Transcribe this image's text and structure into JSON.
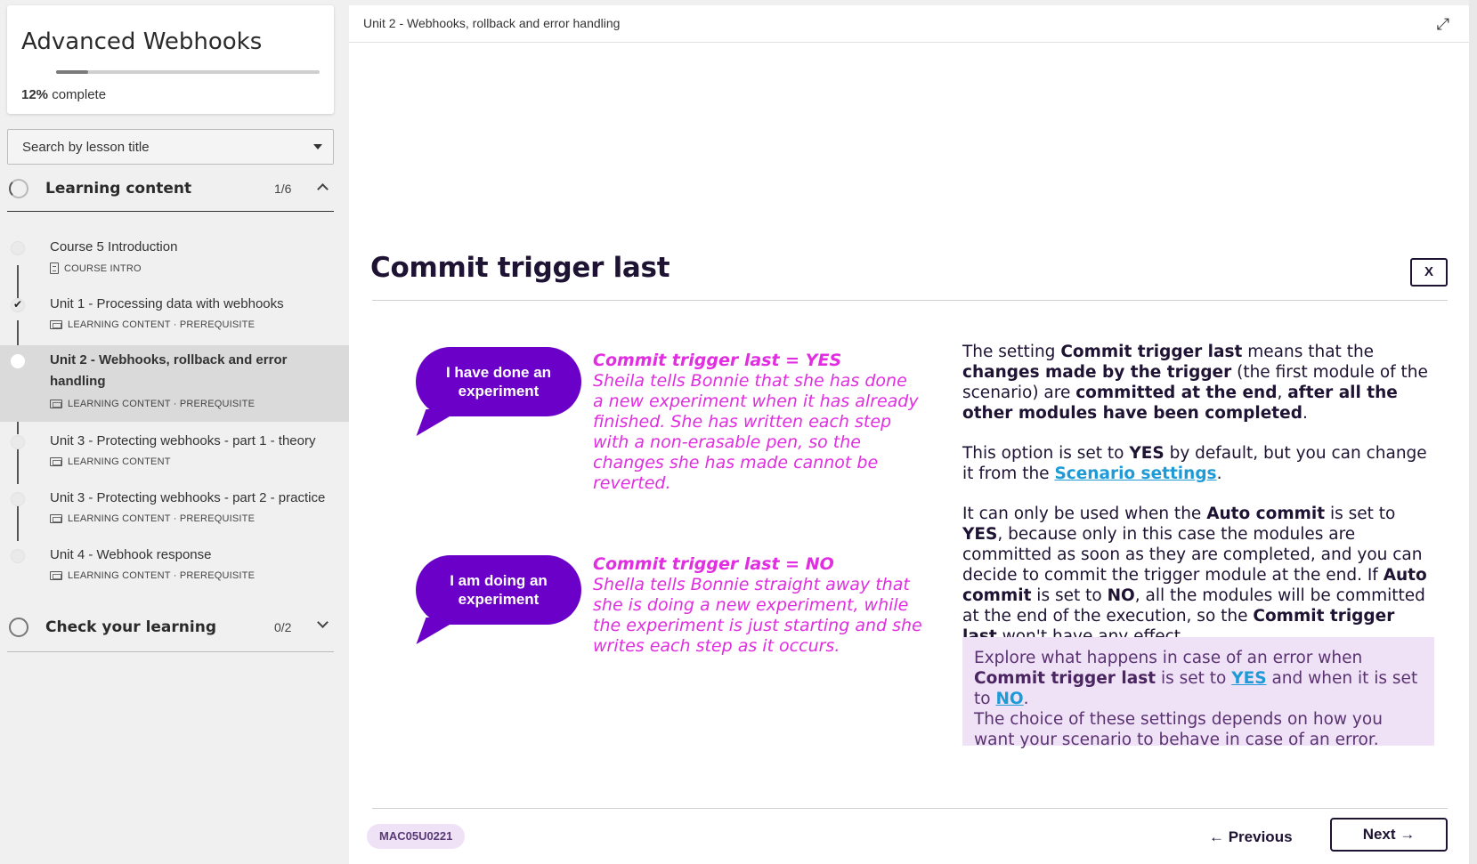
{
  "sidebar": {
    "course_title": "Advanced Webhooks",
    "progress_percent": 12,
    "progress_value": "12%",
    "progress_suffix": "complete",
    "search_placeholder": "Search by lesson title",
    "sections": [
      {
        "label": "Learning content",
        "count": "1/6",
        "expanded": true
      },
      {
        "label": "Check your learning",
        "count": "0/2",
        "expanded": false
      }
    ],
    "lessons": [
      {
        "title": "Course 5 Introduction",
        "meta": "COURSE INTRO",
        "completed": false,
        "active": false
      },
      {
        "title": "Unit 1 - Processing data with webhooks",
        "meta": "LEARNING CONTENT · PREREQUISITE",
        "completed": true,
        "active": false
      },
      {
        "title_line1": "Unit 2 - Webhooks, rollback and error",
        "title_line2": "handling",
        "meta": "LEARNING CONTENT · PREREQUISITE",
        "completed": false,
        "active": true
      },
      {
        "title": "Unit 3 - Protecting webhooks - part 1 - theory",
        "meta": "LEARNING CONTENT",
        "completed": false,
        "active": false
      },
      {
        "title": "Unit 3 - Protecting webhooks - part 2 - practice",
        "meta": "LEARNING CONTENT · PREREQUISITE",
        "completed": false,
        "active": false
      },
      {
        "title": "Unit 4 - Webhook response",
        "meta": "LEARNING CONTENT · PREREQUISITE",
        "completed": false,
        "active": false
      }
    ]
  },
  "main": {
    "breadcrumb": "Unit 2 - Webhooks, rollback and error handling",
    "heading": "Commit trigger last",
    "close_label": "X",
    "bubble_yes": "I have done an experiment",
    "bubble_no": "I am doing an experiment",
    "yes_title": "Commit trigger last = YES",
    "yes_text": "Sheila tells Bonnie that she has done a new experiment when it has already finished. She has written each step with a non-erasable pen, so the changes she has made cannot be reverted.",
    "no_title": "Commit trigger last = NO",
    "no_text": "Shella tells Bonnie straight away that she is doing a new experiment, while the experiment is just starting and she writes each step as it occurs.",
    "para1": {
      "t1": "The setting ",
      "b1": "Commit trigger last",
      "t2": " means that the ",
      "b2": "changes made by the trigger",
      "t3": " (the first module of the scenario) are ",
      "b3": "committed at the end",
      "t4": ", ",
      "b4": "after all the other modules have been completed",
      "t5": "."
    },
    "para2": {
      "t1": "This option is set to ",
      "b1": "YES",
      "t2": " by default, but you can change it from the ",
      "link": "Scenario settings",
      "t3": "."
    },
    "para3": {
      "t1": "It can only be used when the ",
      "b1": "Auto commit",
      "t2": " is set to ",
      "b2": "YES",
      "t3": ", because only in this case the modules are committed as soon as they are completed, and you can decide to commit the trigger module at the end. If ",
      "b3": "Auto commit",
      "t4": " is set to ",
      "b4": "NO",
      "t5": ", all the modules will be committed at the end of the execution, so the ",
      "b5": "Commit trigger last",
      "t6": " won't have any effect."
    },
    "explore": {
      "t1": "Explore what happens in case of an error when ",
      "b1": "Commit trigger last",
      "t2": " is set to ",
      "link_yes": "YES",
      "t3": " and when it is set to ",
      "link_no": "NO",
      "t4": ".",
      "line2": "The choice of these settings depends on how you want your scenario to behave in case of an error."
    },
    "code": "MAC05U0221",
    "prev_label": "← Previous",
    "next_label": "Next →"
  },
  "colors": {
    "bubble": "#6b00c8",
    "pink_text": "#e02ee0",
    "link": "#1e9bd7",
    "explore_bg": "#efe2f7"
  }
}
